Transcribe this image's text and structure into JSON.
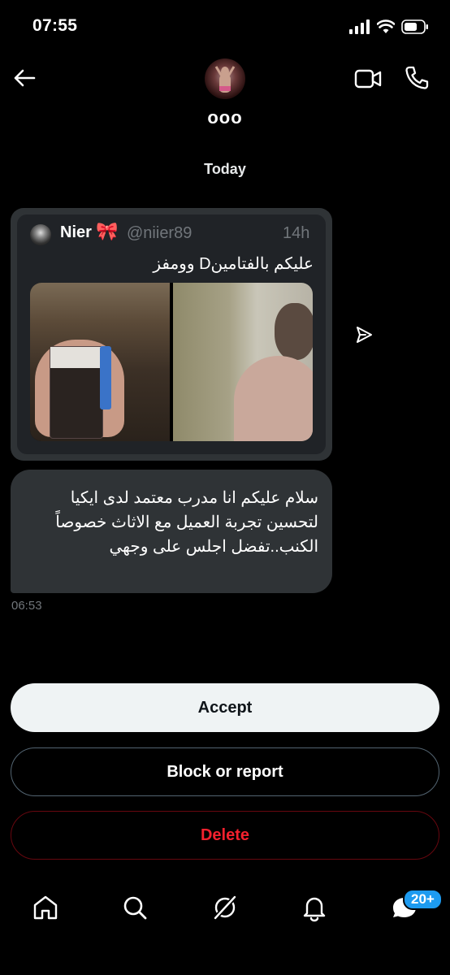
{
  "status": {
    "time": "07:55"
  },
  "header": {
    "username": "ooo"
  },
  "date_separator": "Today",
  "tweet": {
    "name": "Nier",
    "bow": "🎀",
    "handle": "@niier89",
    "time": "14h",
    "text": "عليكم بالفتامينD وومفز"
  },
  "message": {
    "text": "سلام عليكم انا مدرب معتمد لدى ايكيا لتحسين تجربة العميل مع الاثاث خصوصاً الكنب..تفضل اجلس على وجهي",
    "time": "06:53"
  },
  "actions": {
    "accept": "Accept",
    "block": "Block or report",
    "delete": "Delete"
  },
  "nav": {
    "messages_badge": "20+"
  },
  "colors": {
    "accent": "#1d9bf0",
    "danger": "#f4212e",
    "background": "#000000"
  }
}
